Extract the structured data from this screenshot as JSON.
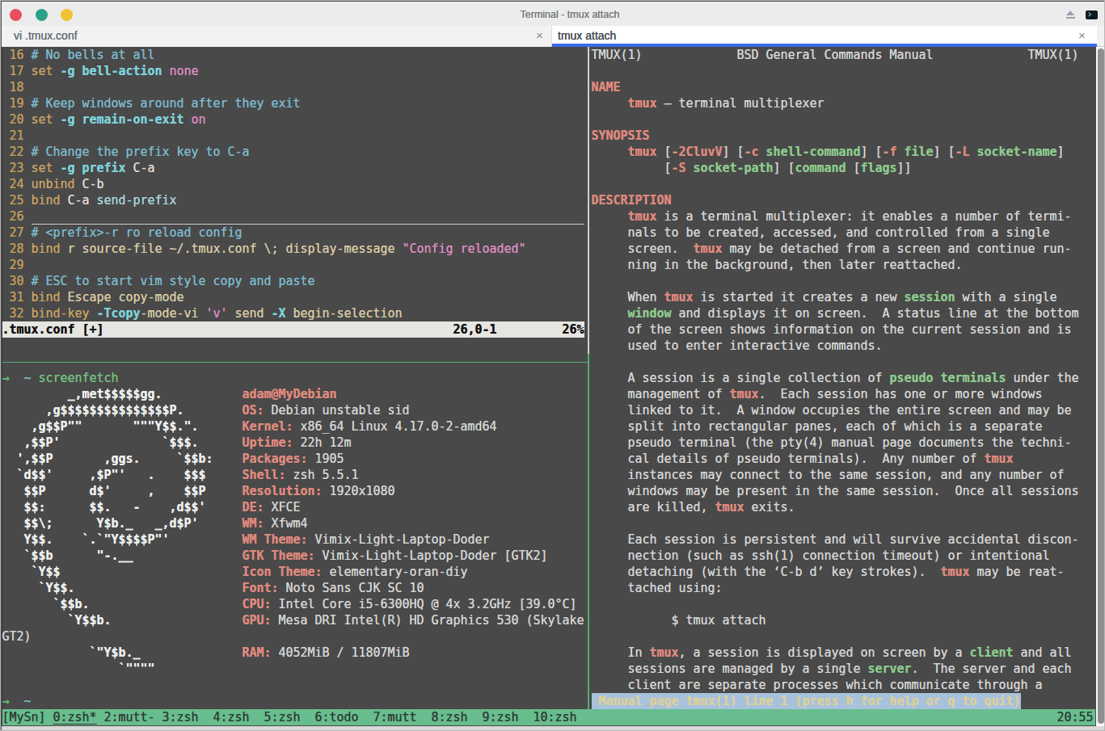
{
  "titlebar": {
    "title": "Terminal - tmux attach"
  },
  "tabs": [
    {
      "label": "vi .tmux.conf",
      "close": "×",
      "active": false
    },
    {
      "label": "tmux attach",
      "close": "×",
      "active": true
    }
  ],
  "colors": {
    "term_bg": "#494949",
    "fg": "#d6d6d6",
    "salmon": "#e0897e",
    "green_bold": "#8cc98c",
    "border_green": "#4fae74",
    "border_gray": "#cfcfcf",
    "status_bg": "#68bd8e",
    "status_fg": "#2e3d34",
    "pager_bg": "#a8c2dc",
    "pager_fg": "#ddd099",
    "vi_num": "#c29d5e",
    "vi_cmd": "#c8a265",
    "vi_comment": "#7cbacd",
    "vi_opt": "#7ed2da",
    "vi_pink": "#dd8cc1",
    "vi_key": "#e6dbd3",
    "vi_warm": "#d9cba4",
    "vi_pcyan": "#a9d6da",
    "vi_status_bg": "#e5e5e2",
    "vi_status_fg": "#111111",
    "art_white": "#efefef",
    "prompt_arrow": "#56b873",
    "prompt_tilde": "#7cc5ce",
    "prompt_cmd": "#76c17f",
    "titlebar_bg": "#ececec",
    "accent_blue": "#3b6ceb",
    "traffic_red": "#e84f5e",
    "traffic_green": "#2aa186",
    "traffic_yellow": "#f1c232"
  },
  "vi": {
    "lines": [
      {
        "n": "16",
        "tk": [
          [
            "com",
            "# No bells at all"
          ]
        ]
      },
      {
        "n": "17",
        "tk": [
          [
            "cmd",
            "set"
          ],
          [
            "warm",
            " "
          ],
          [
            "opt",
            "-g bell-action"
          ],
          [
            "warm",
            " "
          ],
          [
            "pink",
            "none"
          ]
        ]
      },
      {
        "n": "18",
        "tk": []
      },
      {
        "n": "19",
        "tk": [
          [
            "com",
            "# Keep windows around after they exit"
          ]
        ]
      },
      {
        "n": "20",
        "tk": [
          [
            "cmd",
            "set"
          ],
          [
            "warm",
            " "
          ],
          [
            "opt",
            "-g remain-on-exit"
          ],
          [
            "warm",
            " "
          ],
          [
            "pink",
            "on"
          ]
        ]
      },
      {
        "n": "21",
        "tk": []
      },
      {
        "n": "22",
        "tk": [
          [
            "com",
            "# Change the prefix key to C-a"
          ]
        ]
      },
      {
        "n": "23",
        "tk": [
          [
            "cmd",
            "set"
          ],
          [
            "warm",
            " "
          ],
          [
            "opt",
            "-g prefix"
          ],
          [
            "warm",
            " "
          ],
          [
            "key",
            "C-a"
          ]
        ]
      },
      {
        "n": "24",
        "tk": [
          [
            "cmd",
            "unbind"
          ],
          [
            "warm",
            " "
          ],
          [
            "key",
            "C-b"
          ]
        ]
      },
      {
        "n": "25",
        "tk": [
          [
            "cmd",
            "bind"
          ],
          [
            "warm",
            " "
          ],
          [
            "key",
            "C-a"
          ],
          [
            "warm",
            " "
          ],
          [
            "pcyan",
            "send-prefix"
          ]
        ]
      },
      {
        "n": "26",
        "tk": [],
        "cursorline": true
      },
      {
        "n": "27",
        "tk": [
          [
            "com",
            "# <prefix>-r ro reload config"
          ]
        ]
      },
      {
        "n": "28",
        "tk": [
          [
            "cmd",
            "bind"
          ],
          [
            "warm",
            " r source-file ~/.tmux.conf \\; display-message "
          ],
          [
            "pink",
            "\"Config reloaded\""
          ]
        ]
      },
      {
        "n": "29",
        "tk": []
      },
      {
        "n": "30",
        "tk": [
          [
            "com",
            "# ESC to start vim style copy and paste"
          ]
        ]
      },
      {
        "n": "31",
        "tk": [
          [
            "cmd",
            "bind"
          ],
          [
            "warm",
            " Escape copy-mode"
          ]
        ]
      },
      {
        "n": "32",
        "tk": [
          [
            "cmd",
            "bind-key"
          ],
          [
            "warm",
            " "
          ],
          [
            "opt",
            "-Tcopy"
          ],
          [
            "warm",
            "-mode-vi "
          ],
          [
            "pink",
            "'v'"
          ],
          [
            "warm",
            " send "
          ],
          [
            "opt",
            "-X"
          ],
          [
            "warm",
            " begin-selection"
          ]
        ]
      }
    ],
    "statusline": {
      "file": ".tmux.conf [+]",
      "ruler": "26,0-1",
      "percent": "26%"
    }
  },
  "shell": {
    "prompt_symbol": "→",
    "prompt_path": "~",
    "prompt_command": "screenfetch",
    "fetch_rows": [
      {
        "art": "         _,met$$$$$gg.",
        "label": "",
        "value": "adam@MyDebian",
        "user": true
      },
      {
        "art": "      ,g$$$$$$$$$$$$$$$P.",
        "label": "OS:",
        "value": "Debian unstable sid"
      },
      {
        "art": "    ,g$$P\"\"       \"\"\"Y$$.\".",
        "label": "Kernel:",
        "value": "x86_64 Linux 4.17.0-2-amd64"
      },
      {
        "art": "   ,$$P'              `$$$.",
        "label": "Uptime:",
        "value": "22h 12m"
      },
      {
        "art": "  ',$$P       ,ggs.     `$$b:",
        "label": "Packages:",
        "value": "1905"
      },
      {
        "art": "  `d$$'     ,$P\"'   .    $$$",
        "label": "Shell:",
        "value": "zsh 5.5.1"
      },
      {
        "art": "   $$P      d$'     ,    $$P",
        "label": "Resolution:",
        "value": "1920x1080"
      },
      {
        "art": "   $$:      $$.   -    ,d$$'",
        "label": "DE:",
        "value": "XFCE"
      },
      {
        "art": "   $$\\;      Y$b._   _,d$P'",
        "label": "WM:",
        "value": "Xfwm4"
      },
      {
        "art": "   Y$$.    `.`\"Y$$$$P\"'",
        "label": "WM Theme:",
        "value": "Vimix-Light-Laptop-Doder"
      },
      {
        "art": "   `$$b      \"-.__",
        "label": "GTK Theme:",
        "value": "Vimix-Light-Laptop-Doder [GTK2]"
      },
      {
        "art": "    `Y$$",
        "label": "Icon Theme:",
        "value": "elementary-oran-diy"
      },
      {
        "art": "     `Y$$.",
        "label": "Font:",
        "value": "Noto Sans CJK SC 10"
      },
      {
        "art": "       `$$b.",
        "label": "CPU:",
        "value": "Intel Core i5-6300HQ @ 4x 3.2GHz [39.0°C]"
      },
      {
        "art": "         `Y$$b.",
        "label": "GPU:",
        "value": "Mesa DRI Intel(R) HD Graphics 530 (Skylake"
      },
      {
        "art": "",
        "label": "",
        "value": "GT2)",
        "wrap": true
      },
      {
        "art": "            `\"Y$b._",
        "label": "RAM:",
        "value": "4052MiB / 11807MiB"
      },
      {
        "art": "                `\"\"\"\"",
        "label": "",
        "value": ""
      }
    ]
  },
  "man": {
    "lines": [
      {
        "r": 0,
        "tk": [
          [
            "body",
            "TMUX(1)             BSD General Commands Manual             TMUX(1)"
          ]
        ]
      },
      {
        "r": 2,
        "tk": [
          [
            "salmon",
            "NAME"
          ]
        ]
      },
      {
        "r": 3,
        "tk": [
          [
            "body",
            "     "
          ],
          [
            "salmon",
            "tmux"
          ],
          [
            "body",
            " — terminal multiplexer"
          ]
        ]
      },
      {
        "r": 5,
        "tk": [
          [
            "salmon",
            "SYNOPSIS"
          ]
        ]
      },
      {
        "r": 6,
        "tk": [
          [
            "body",
            "     "
          ],
          [
            "salmon",
            "tmux"
          ],
          [
            "body",
            " ["
          ],
          [
            "salmon",
            "-2CluvV"
          ],
          [
            "body",
            "] ["
          ],
          [
            "salmon",
            "-c"
          ],
          [
            "body",
            " "
          ],
          [
            "green",
            "shell-command"
          ],
          [
            "body",
            "] ["
          ],
          [
            "salmon",
            "-f"
          ],
          [
            "body",
            " "
          ],
          [
            "green",
            "file"
          ],
          [
            "body",
            "] ["
          ],
          [
            "salmon",
            "-L"
          ],
          [
            "body",
            " "
          ],
          [
            "green",
            "socket-name"
          ],
          [
            "body",
            "]"
          ]
        ]
      },
      {
        "r": 7,
        "tk": [
          [
            "body",
            "          ["
          ],
          [
            "salmon",
            "-S"
          ],
          [
            "body",
            " "
          ],
          [
            "green",
            "socket-path"
          ],
          [
            "body",
            "] ["
          ],
          [
            "green",
            "command"
          ],
          [
            "body",
            " ["
          ],
          [
            "green",
            "flags"
          ],
          [
            "body",
            "]]"
          ]
        ]
      },
      {
        "r": 9,
        "tk": [
          [
            "salmon",
            "DESCRIPTION"
          ]
        ]
      },
      {
        "r": 10,
        "tk": [
          [
            "body",
            "     "
          ],
          [
            "salmon",
            "tmux"
          ],
          [
            "body",
            " is a terminal multiplexer: it enables a number of termi-"
          ]
        ]
      },
      {
        "r": 11,
        "tk": [
          [
            "body",
            "     nals to be created, accessed, and controlled from a single"
          ]
        ]
      },
      {
        "r": 12,
        "tk": [
          [
            "body",
            "     screen.  "
          ],
          [
            "salmon",
            "tmux"
          ],
          [
            "body",
            " may be detached from a screen and continue run-"
          ]
        ]
      },
      {
        "r": 13,
        "tk": [
          [
            "body",
            "     ning in the background, then later reattached."
          ]
        ]
      },
      {
        "r": 15,
        "tk": [
          [
            "body",
            "     When "
          ],
          [
            "salmon",
            "tmux"
          ],
          [
            "body",
            " is started it creates a new "
          ],
          [
            "green",
            "session"
          ],
          [
            "body",
            " with a single"
          ]
        ]
      },
      {
        "r": 16,
        "tk": [
          [
            "body",
            "     "
          ],
          [
            "green",
            "window"
          ],
          [
            "body",
            " and displays it on screen.  A status line at the bottom"
          ]
        ]
      },
      {
        "r": 17,
        "tk": [
          [
            "body",
            "     of the screen shows information on the current session and is"
          ]
        ]
      },
      {
        "r": 18,
        "tk": [
          [
            "body",
            "     used to enter interactive commands."
          ]
        ]
      },
      {
        "r": 20,
        "tk": [
          [
            "body",
            "     A session is a single collection of "
          ],
          [
            "green",
            "pseudo terminals"
          ],
          [
            "body",
            " under the"
          ]
        ]
      },
      {
        "r": 21,
        "tk": [
          [
            "body",
            "     management of "
          ],
          [
            "salmon",
            "tmux"
          ],
          [
            "body",
            ".  Each session has one or more windows"
          ]
        ]
      },
      {
        "r": 22,
        "tk": [
          [
            "body",
            "     linked to it.  A window occupies the entire screen and may be"
          ]
        ]
      },
      {
        "r": 23,
        "tk": [
          [
            "body",
            "     split into rectangular panes, each of which is a separate"
          ]
        ]
      },
      {
        "r": 24,
        "tk": [
          [
            "body",
            "     pseudo terminal (the pty(4) manual page documents the techni-"
          ]
        ]
      },
      {
        "r": 25,
        "tk": [
          [
            "body",
            "     cal details of pseudo terminals).  Any number of "
          ],
          [
            "salmon",
            "tmux"
          ]
        ]
      },
      {
        "r": 26,
        "tk": [
          [
            "body",
            "     instances may connect to the same session, and any number of"
          ]
        ]
      },
      {
        "r": 27,
        "tk": [
          [
            "body",
            "     windows may be present in the same session.  Once all sessions"
          ]
        ]
      },
      {
        "r": 28,
        "tk": [
          [
            "body",
            "     are killed, "
          ],
          [
            "salmon",
            "tmux"
          ],
          [
            "body",
            " exits."
          ]
        ]
      },
      {
        "r": 30,
        "tk": [
          [
            "body",
            "     Each session is persistent and will survive accidental discon-"
          ]
        ]
      },
      {
        "r": 31,
        "tk": [
          [
            "body",
            "     nection (such as ssh(1) connection timeout) or intentional"
          ]
        ]
      },
      {
        "r": 32,
        "tk": [
          [
            "body",
            "     detaching (with the ‘C-b d’ key strokes).  "
          ],
          [
            "salmon",
            "tmux"
          ],
          [
            "body",
            " may be reat-"
          ]
        ]
      },
      {
        "r": 33,
        "tk": [
          [
            "body",
            "     tached using:"
          ]
        ]
      },
      {
        "r": 35,
        "tk": [
          [
            "body",
            "           $ tmux attach"
          ]
        ]
      },
      {
        "r": 37,
        "tk": [
          [
            "body",
            "     In "
          ],
          [
            "salmon",
            "tmux"
          ],
          [
            "body",
            ", a session is displayed on screen by a "
          ],
          [
            "green",
            "client"
          ],
          [
            "body",
            " and all"
          ]
        ]
      },
      {
        "r": 38,
        "tk": [
          [
            "body",
            "     sessions are managed by a single "
          ],
          [
            "green",
            "server"
          ],
          [
            "body",
            ".  The server and each"
          ]
        ]
      },
      {
        "r": 39,
        "tk": [
          [
            "body",
            "     client are separate processes which communicate through a"
          ]
        ]
      }
    ],
    "pager_status": " Manual page tmux(1) line 1 (press h for help or q to quit)"
  },
  "tmux_status": {
    "session": "[MySn] ",
    "current_window": "0:zsh*",
    "other_windows": " 2:mutt- 3:zsh  4:zsh  5:zsh  6:todo  7:mutt  8:zsh  9:zsh  10:zsh",
    "time": "20:55"
  }
}
